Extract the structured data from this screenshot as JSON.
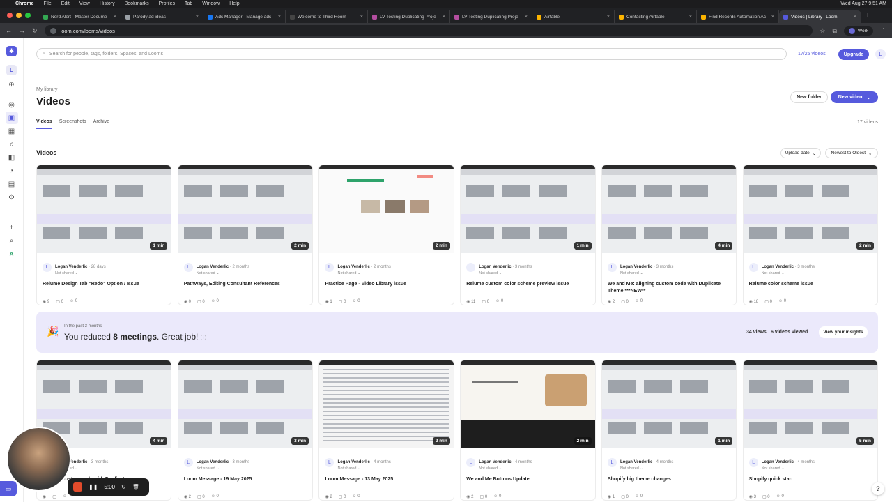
{
  "menubar": {
    "app": "Chrome",
    "items": [
      "File",
      "Edit",
      "View",
      "History",
      "Bookmarks",
      "Profiles",
      "Tab",
      "Window",
      "Help"
    ],
    "clock": "Wed Aug 27  9:51 AM"
  },
  "tabs": [
    {
      "title": "Nerd Alert - Master Docume",
      "color": "#34a853"
    },
    {
      "title": "Parody ad ideas",
      "color": "#9aa0a6"
    },
    {
      "title": "Ads Manager - Manage ads",
      "color": "#1877f2"
    },
    {
      "title": "Welcome to Third Room",
      "color": "#444444"
    },
    {
      "title": "LV Testing Duplicating Proje",
      "color": "#b44ea0"
    },
    {
      "title": "LV Testing Duplicating Proje",
      "color": "#b44ea0"
    },
    {
      "title": "Airtable",
      "color": "#fcb400"
    },
    {
      "title": "Contacting Airtable",
      "color": "#fcb400"
    },
    {
      "title": "Find Records Automation Ac",
      "color": "#fcb400"
    },
    {
      "title": "Videos | Library | Loom",
      "color": "#565add",
      "active": true
    }
  ],
  "address": {
    "url": "loom.com/looms/videos",
    "profile": "Work"
  },
  "rail": {
    "workspace_initial": "L",
    "bottom_initial": "A"
  },
  "search": {
    "placeholder": "Search for people, tags, folders, Spaces, and Looms"
  },
  "header": {
    "quota": "17/25 videos",
    "upgrade": "Upgrade",
    "avatar_initial": "L",
    "breadcrumb": "My library",
    "title": "Videos",
    "new_folder": "New folder",
    "new_video": "New video"
  },
  "content_tabs": [
    "Videos",
    "Screenshots",
    "Archive"
  ],
  "video_count": "17 videos",
  "section": {
    "label": "Videos",
    "sort_field": "Upload date",
    "sort_order": "Newest to Oldest"
  },
  "row1": [
    {
      "author": "Logan Venderlic",
      "ago": "28 days",
      "shared": "Not shared",
      "title": "Relume Design Tab \"Redo\" Option / Issue",
      "duration": "1 min",
      "views": "9",
      "comments": "0",
      "reactions": "0"
    },
    {
      "author": "Logan Venderlic",
      "ago": "2 months",
      "shared": "Not shared",
      "title": "Pathways, Editing Consultant References",
      "duration": "2 min",
      "views": "0",
      "comments": "0",
      "reactions": "0"
    },
    {
      "author": "Logan Venderlic",
      "ago": "2 months",
      "shared": "Not shared",
      "title": "Practice Page - Video Library issue",
      "duration": "2 min",
      "views": "1",
      "comments": "0",
      "reactions": "0"
    },
    {
      "author": "Logan Venderlic",
      "ago": "3 months",
      "shared": "Not shared",
      "title": "Relume custom color scheme preview issue",
      "duration": "1 min",
      "views": "11",
      "comments": "0",
      "reactions": "0"
    },
    {
      "author": "Logan Venderlic",
      "ago": "3 months",
      "shared": "Not shared",
      "title": "We and Me: aligning custom code with Duplicate Theme ***NEW**",
      "duration": "4 min",
      "views": "2",
      "comments": "0",
      "reactions": "0"
    },
    {
      "author": "Logan Venderlic",
      "ago": "3 months",
      "shared": "Not shared",
      "title": "Relume color scheme issue",
      "duration": "2 min",
      "views": "18",
      "comments": "0",
      "reactions": "0"
    }
  ],
  "banner": {
    "period": "In the past 3 months",
    "prefix": "You reduced ",
    "highlight": "8 meetings",
    "suffix": ". Great job!",
    "views": "34 views",
    "viewed": "6 videos viewed",
    "cta": "View your insights"
  },
  "row2": [
    {
      "author": "Logan Venderlic",
      "ago": "3 months",
      "shared": "Not shared",
      "title": "aligning custom code with Duplicate",
      "duration": "4 min",
      "views": "",
      "comments": "",
      "reactions": ""
    },
    {
      "author": "Logan Venderlic",
      "ago": "3 months",
      "shared": "Not shared",
      "title": "Loom Message - 19 May 2025",
      "duration": "3 min",
      "views": "2",
      "comments": "0",
      "reactions": "0"
    },
    {
      "author": "Logan Venderlic",
      "ago": "4 months",
      "shared": "Not shared",
      "title": "Loom Message - 13 May 2025",
      "duration": "2 min",
      "views": "2",
      "comments": "0",
      "reactions": "0"
    },
    {
      "author": "Logan Venderlic",
      "ago": "4 months",
      "shared": "Not shared",
      "title": "We and Me Buttons Update",
      "duration": "2 min",
      "views": "2",
      "comments": "0",
      "reactions": "0"
    },
    {
      "author": "Logan Venderlic",
      "ago": "4 months",
      "shared": "Not shared",
      "title": "Shopify big theme changes",
      "duration": "1 min",
      "views": "1",
      "comments": "0",
      "reactions": "0"
    },
    {
      "author": "Logan Venderlic",
      "ago": "4 months",
      "shared": "Not shared",
      "title": "Shopify quick start",
      "duration": "5 min",
      "views": "3",
      "comments": "0",
      "reactions": "0"
    }
  ],
  "recorder": {
    "time": "5:00"
  },
  "help": "?",
  "colors": {
    "accent": "#565add",
    "banner": "#ebe9fb",
    "record": "#e24b2b"
  }
}
